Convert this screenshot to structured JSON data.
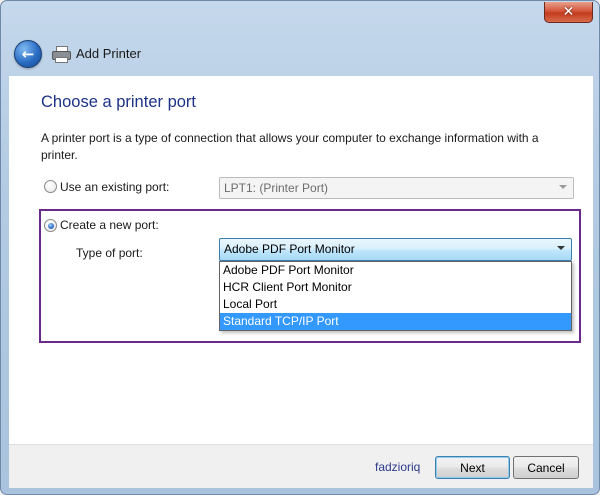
{
  "window": {
    "close_glyph": "✕",
    "title": "Add Printer"
  },
  "icons": {
    "back": "back-arrow-icon",
    "printer": "printer-icon",
    "close": "close-icon",
    "dropdown_arrow": "chevron-down-icon"
  },
  "page": {
    "heading": "Choose a printer port",
    "description": "A printer port is a type of connection that allows your computer to exchange information with a printer."
  },
  "existing_port": {
    "label": "Use an existing port:",
    "value": "LPT1: (Printer Port)",
    "selected": false,
    "enabled": false
  },
  "new_port": {
    "label": "Create a new port:",
    "selected": true,
    "type_label": "Type of port:",
    "current_value": "Adobe PDF Port Monitor",
    "options": [
      "Adobe PDF Port Monitor",
      "HCR Client Port Monitor",
      "Local Port",
      "Standard TCP/IP Port"
    ],
    "highlighted_option": "Standard TCP/IP Port"
  },
  "footer": {
    "watermark": "fadzioriq",
    "next_label": "Next",
    "cancel_label": "Cancel"
  },
  "colors": {
    "heading": "#1e3287",
    "highlight": "#3399ff",
    "annotation_border": "#6a2a8c",
    "close_button": "#c23c1d"
  }
}
